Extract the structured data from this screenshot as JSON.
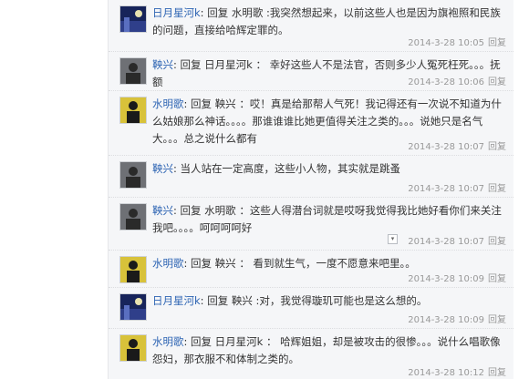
{
  "replies": [
    {
      "author": "日月星河k",
      "text": ": 回复 水明歌 :我突然想起来，以前这些人也是因为旗袍照和民族的问题，直接给哈辉定罪的。",
      "timestamp": "2014-3-28 10:05",
      "reply_label": "回复",
      "avatar": "avatar-blue-night-scene"
    },
    {
      "author": "鞅兴",
      "text": ": 回复 日月星河k ： 幸好这些人不是法官，否则多少人冤死枉死。。。抚额",
      "timestamp": "2014-3-28 10:06",
      "reply_label": "回复",
      "avatar": "avatar-gray-figure"
    },
    {
      "author": "水明歌",
      "text": ": 回复 鞅兴 ：哎！真是给那帮人气死！我记得还有一次说不知道为什么姑娘那么神话。。。。那谁谁谁比她更值得关注之类的。。。说她只是名气大。。。总之说什么都有",
      "timestamp": "2014-3-28 10:07",
      "reply_label": "回复",
      "avatar": "avatar-yellow-black-figure"
    },
    {
      "author": "鞅兴",
      "text": ": 当人站在一定高度，这些小人物，其实就是跳蚤",
      "timestamp": "2014-3-28 10:07",
      "reply_label": "回复",
      "avatar": "avatar-gray-figure"
    },
    {
      "author": "鞅兴",
      "text": ": 回复 水明歌 ：这些人得潜台词就是哎呀我觉得我比她好看你们来关注我吧。。。。呵呵呵呵好",
      "timestamp": "2014-3-28 10:07",
      "reply_label": "回复",
      "avatar": "avatar-gray-figure"
    },
    {
      "author": "水明歌",
      "text": ": 回复 鞅兴 ： 看到就生气，一度不愿意来吧里。。",
      "timestamp": "2014-3-28 10:09",
      "reply_label": "回复",
      "avatar": "avatar-yellow-black-figure"
    },
    {
      "author": "日月星河k",
      "text": ": 回复 鞅兴 :对，我觉得璇玑可能也是这么想的。",
      "timestamp": "2014-3-28 10:09",
      "reply_label": "回复",
      "avatar": "avatar-blue-night-scene"
    },
    {
      "author": "水明歌",
      "text": ": 回复 日月星河k ： 哈辉姐姐，却是被攻击的很惨。。。说什么唱歌像怨妇，那衣服不和体制之类的。",
      "timestamp": "2014-3-28 10:12",
      "reply_label": "回复",
      "avatar": "avatar-yellow-black-figure"
    }
  ],
  "collapse_icon": "▾",
  "colors": {
    "author": "#2d64b3",
    "thread_bg": "#f5f6f8",
    "meta": "#999999"
  }
}
